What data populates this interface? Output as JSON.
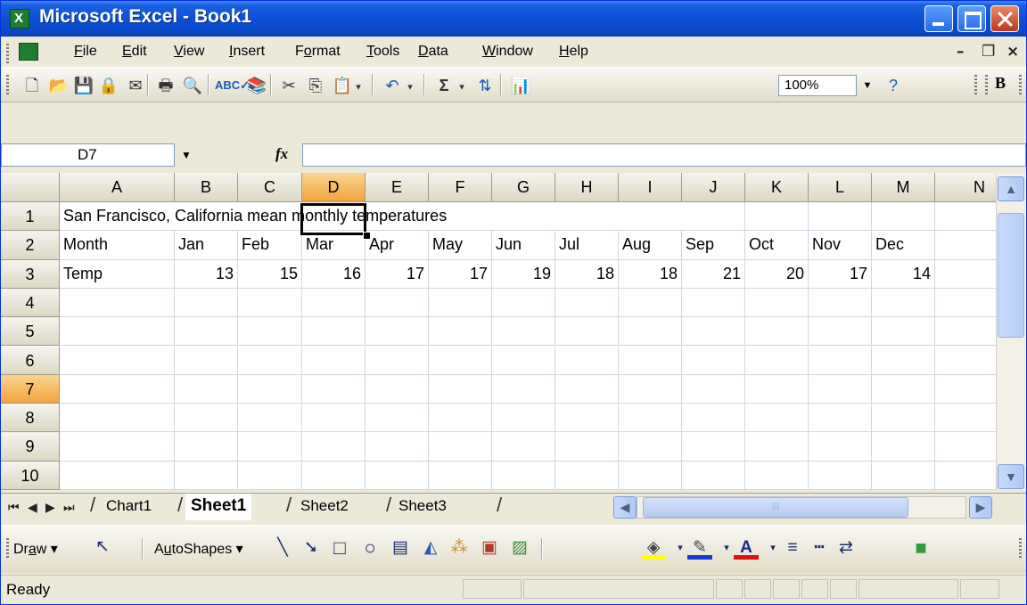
{
  "window": {
    "title": "Microsoft Excel - Book1"
  },
  "menubar": {
    "items": [
      {
        "pre": "",
        "acc": "F",
        "post": "ile"
      },
      {
        "pre": "",
        "acc": "E",
        "post": "dit"
      },
      {
        "pre": "",
        "acc": "V",
        "post": "iew"
      },
      {
        "pre": "",
        "acc": "I",
        "post": "nsert"
      },
      {
        "pre": "F",
        "acc": "o",
        "post": "rmat"
      },
      {
        "pre": "",
        "acc": "T",
        "post": "ools"
      },
      {
        "pre": "",
        "acc": "D",
        "post": "ata"
      },
      {
        "pre": "",
        "acc": "W",
        "post": "indow"
      },
      {
        "pre": "",
        "acc": "H",
        "post": "elp"
      }
    ]
  },
  "toolbar": {
    "zoom": "100%",
    "bold_label": "B",
    "autosum_label": "Σ"
  },
  "formula_bar": {
    "name_box": "D7",
    "fx_label": "fx",
    "formula": ""
  },
  "grid": {
    "columns": [
      "A",
      "B",
      "C",
      "D",
      "E",
      "F",
      "G",
      "H",
      "I",
      "J",
      "K",
      "L",
      "M",
      "N"
    ],
    "rows": [
      "1",
      "2",
      "3",
      "4",
      "5",
      "6",
      "7",
      "8",
      "9",
      "10"
    ],
    "selected_column": "D",
    "selected_row": "7",
    "cells": [
      [
        "San Francisco, California mean monthly temperatures",
        "",
        "",
        "",
        "",
        "",
        "",
        "",
        "",
        "",
        "",
        "",
        ""
      ],
      [
        "Month",
        "Jan",
        "Feb",
        "Mar",
        "Apr",
        "May",
        "Jun",
        "Jul",
        "Aug",
        "Sep",
        "Oct",
        "Nov",
        "Dec"
      ],
      [
        "Temp",
        "13",
        "15",
        "16",
        "17",
        "17",
        "19",
        "18",
        "18",
        "21",
        "20",
        "17",
        "14"
      ]
    ]
  },
  "sheets": {
    "tabs": [
      "Chart1",
      "Sheet1",
      "Sheet2",
      "Sheet3"
    ],
    "active": "Sheet1"
  },
  "drawing": {
    "draw_pre": "Dr",
    "draw_acc": "a",
    "draw_post": "w",
    "autoshapes_pre": "A",
    "autoshapes_acc": "u",
    "autoshapes_post": "toShapes"
  },
  "status": {
    "text": "Ready"
  },
  "colors": {
    "title_blue": "#0b4fd6",
    "selected_header": "#f2a43c",
    "gridline": "#d0d7e5"
  }
}
